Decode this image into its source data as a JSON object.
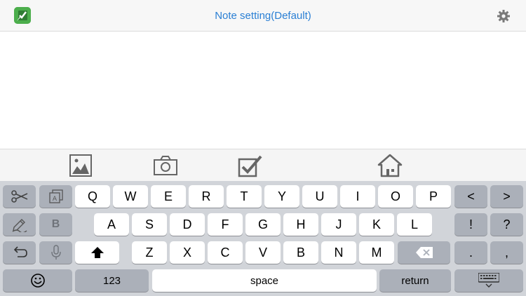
{
  "header": {
    "title": "Note setting(Default)",
    "app_icon": "app-logo-checkmark-icon",
    "settings_icon": "gear-icon"
  },
  "toolbar": {
    "items": [
      "image-icon",
      "camera-icon",
      "checkbox-icon",
      "home-icon"
    ]
  },
  "keyboard": {
    "row1": [
      "Q",
      "W",
      "E",
      "R",
      "T",
      "Y",
      "U",
      "I",
      "O",
      "P"
    ],
    "row2": [
      "A",
      "S",
      "D",
      "F",
      "G",
      "H",
      "J",
      "K",
      "L"
    ],
    "row3": [
      "Z",
      "X",
      "C",
      "V",
      "B",
      "N",
      "M"
    ],
    "left_column_icons": [
      "scissors-icon",
      "stylus-icon",
      "undo-icon"
    ],
    "second_column": [
      "text-box-icon",
      "B",
      "microphone-icon"
    ],
    "right_column_1": [
      "<",
      "!",
      "."
    ],
    "right_column_2": [
      ">",
      "?",
      ","
    ],
    "numbers_key": "123",
    "space_key": "space",
    "return_key": "return",
    "emoji_icon": "emoji-icon",
    "dismiss_icon": "keyboard-dismiss-icon",
    "shift_icon": "shift-icon",
    "delete_icon": "delete-icon"
  },
  "colors": {
    "title_blue": "#2a7fd4",
    "app_green": "#5cb85c",
    "keyboard_bg": "#d1d4d9",
    "dark_key": "#abb0b9"
  }
}
